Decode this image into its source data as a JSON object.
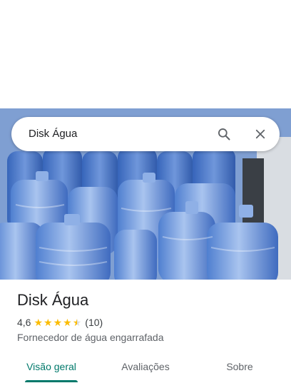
{
  "search": {
    "query": "Disk Água"
  },
  "place": {
    "name": "Disk Água",
    "rating": "4,6",
    "stars": [
      1,
      1,
      1,
      1,
      0.5
    ],
    "review_count": "(10)",
    "category": "Fornecedor de água engarrafada"
  },
  "tabs": [
    {
      "label": "Visão geral",
      "active": true
    },
    {
      "label": "Avaliações",
      "active": false
    },
    {
      "label": "Sobre",
      "active": false
    }
  ],
  "icons": {
    "search": "search-icon",
    "close": "close-icon",
    "star": "star-icon"
  },
  "colors": {
    "accent": "#00796b",
    "star": "#fbbc04",
    "star_empty": "#dadce0"
  }
}
